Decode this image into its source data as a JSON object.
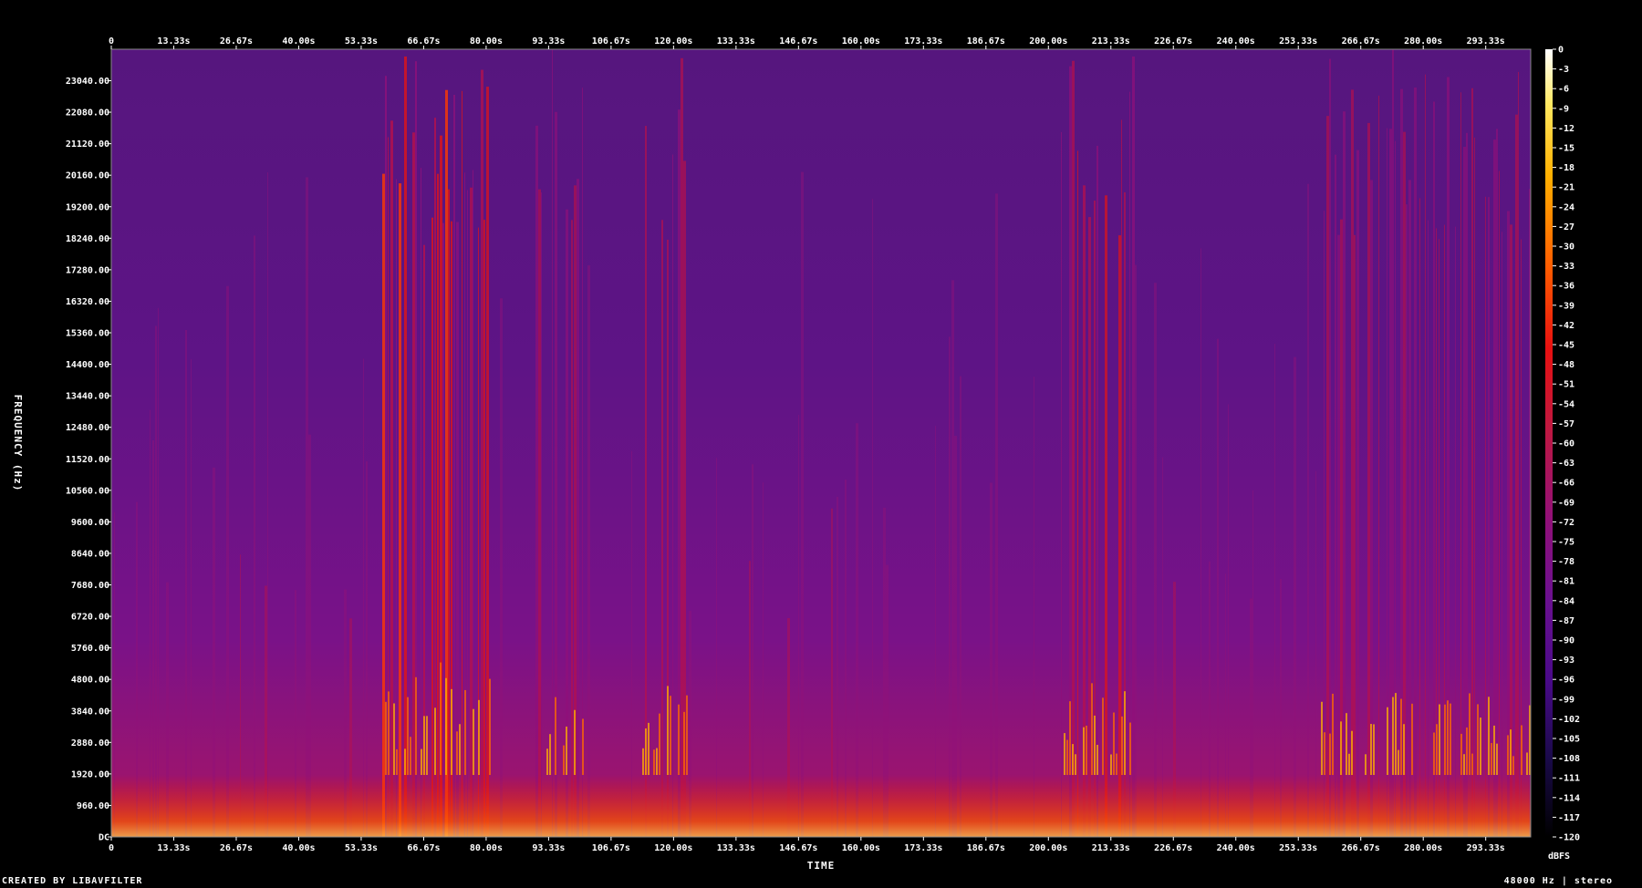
{
  "chart_data": {
    "type": "heatmap",
    "title": "",
    "xlabel": "TIME",
    "ylabel": "FREQUENCY (Hz)",
    "colorbar_unit": "dBFS",
    "x_ticks": [
      "0",
      "13.33s",
      "26.67s",
      "40.00s",
      "53.33s",
      "66.67s",
      "80.00s",
      "93.33s",
      "106.67s",
      "120.00s",
      "133.33s",
      "146.67s",
      "160.00s",
      "173.33s",
      "186.67s",
      "200.00s",
      "213.33s",
      "226.67s",
      "240.00s",
      "253.33s",
      "266.67s",
      "280.00s",
      "293.33s"
    ],
    "x_range_s": [
      0,
      300
    ],
    "y_ticks": [
      "23040.00",
      "22080.00",
      "21120.00",
      "20160.00",
      "19200.00",
      "18240.00",
      "17280.00",
      "16320.00",
      "15360.00",
      "14400.00",
      "13440.00",
      "12480.00",
      "11520.00",
      "10560.00",
      "9600.00",
      "8640.00",
      "7680.00",
      "6720.00",
      "5760.00",
      "4800.00",
      "3840.00",
      "2880.00",
      "1920.00",
      "960.00",
      "DC"
    ],
    "y_range_hz": [
      0,
      24000
    ],
    "colorbar_ticks": [
      "0",
      "-3",
      "-6",
      "-9",
      "-12",
      "-15",
      "-18",
      "-21",
      "-24",
      "-27",
      "-30",
      "-33",
      "-36",
      "-39",
      "-42",
      "-45",
      "-48",
      "-51",
      "-54",
      "-57",
      "-60",
      "-63",
      "-66",
      "-69",
      "-72",
      "-75",
      "-78",
      "-81",
      "-84",
      "-87",
      "-90",
      "-93",
      "-96",
      "-99",
      "-102",
      "-105",
      "-108",
      "-111",
      "-114",
      "-117",
      "-120"
    ],
    "colorbar_range_db": [
      -120,
      0
    ],
    "colormap": [
      "#000000",
      "#1a0a4a",
      "#4a0a8a",
      "#6a1090",
      "#90107a",
      "#c01840",
      "#e81010",
      "#ff5a00",
      "#ffb000",
      "#ffe860",
      "#ffffff"
    ],
    "loud_regions": [
      {
        "t_start": 57,
        "t_end": 72,
        "level": 0.9
      },
      {
        "t_start": 72,
        "t_end": 80,
        "level": 0.75
      },
      {
        "t_start": 88,
        "t_end": 100,
        "level": 0.6
      },
      {
        "t_start": 112,
        "t_end": 122,
        "level": 0.65
      },
      {
        "t_start": 200,
        "t_end": 216,
        "level": 0.7
      },
      {
        "t_start": 255,
        "t_end": 300,
        "level": 0.6
      }
    ]
  },
  "footer": {
    "left": "CREATED BY LIBAVFILTER",
    "right": "48000 Hz | stereo"
  }
}
